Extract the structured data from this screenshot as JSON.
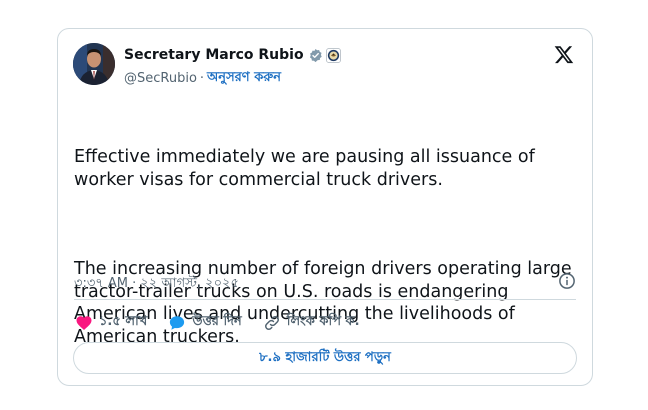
{
  "author": {
    "name": "Secretary Marco Rubio",
    "handle": "@SecRubio",
    "separator": "·",
    "follow_label": "অনুসরণ করুন"
  },
  "tweet": {
    "paragraph_1": "Effective immediately we are pausing all issuance of worker visas for commercial truck drivers.",
    "paragraph_2": "The increasing number of foreign drivers operating large tractor-trailer trucks on U.S. roads is endangering American lives and undercutting the livelihoods of American truckers.",
    "timestamp": "৩:৩৭ AM · ২২ আগস্ট, ২০২৫"
  },
  "actions": {
    "like_count": "১.৫ লাখ",
    "reply_label": "উত্তর দিন",
    "copy_link_label": "লিংক কপি ক."
  },
  "read_replies_label": "৮.৯ হাজারটি উত্তর পড়ুন",
  "icons": {
    "verified": "verified-badge-icon",
    "seal": "government-seal-icon",
    "x": "x-logo-icon",
    "info": "info-icon",
    "like": "heart-icon",
    "reply": "speech-bubble-icon",
    "link": "link-icon"
  },
  "colors": {
    "accent": "#1d6fc2",
    "heart": "#f91880",
    "reply": "#1d9bf0",
    "text": "#0f1419",
    "muted": "#536471",
    "border": "#cfd9de"
  }
}
